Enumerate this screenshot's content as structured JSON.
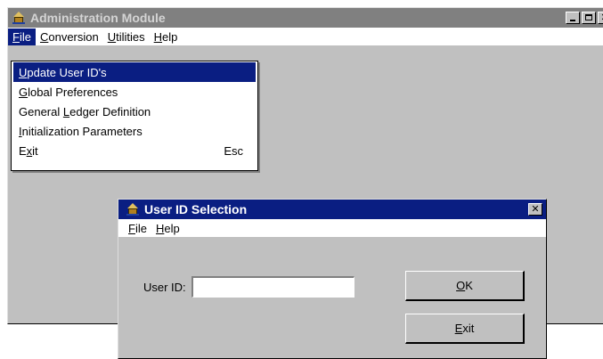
{
  "main_window": {
    "title": "Administration Module",
    "menu": [
      {
        "first": "F",
        "rest": "ile"
      },
      {
        "first": "C",
        "rest": "onversion"
      },
      {
        "first": "U",
        "rest": "tilities"
      },
      {
        "first": "H",
        "rest": "elp"
      }
    ]
  },
  "file_menu": {
    "items": [
      {
        "pre": "",
        "key": "U",
        "post": "pdate User ID's",
        "shortcut": ""
      },
      {
        "pre": "",
        "key": "G",
        "post": "lobal Preferences",
        "shortcut": ""
      },
      {
        "pre": "General ",
        "key": "L",
        "post": "edger Definition",
        "shortcut": ""
      },
      {
        "pre": "",
        "key": "I",
        "post": "nitialization Parameters",
        "shortcut": ""
      },
      {
        "pre": "E",
        "key": "x",
        "post": "it",
        "shortcut": "Esc"
      }
    ]
  },
  "dialog": {
    "title": "User ID Selection",
    "menu": [
      {
        "first": "F",
        "rest": "ile"
      },
      {
        "first": "H",
        "rest": "elp"
      }
    ],
    "user_id_label": "User ID:",
    "user_id_value": "",
    "ok_first": "O",
    "ok_rest": "K",
    "exit_first": "E",
    "exit_rest": "xit"
  }
}
